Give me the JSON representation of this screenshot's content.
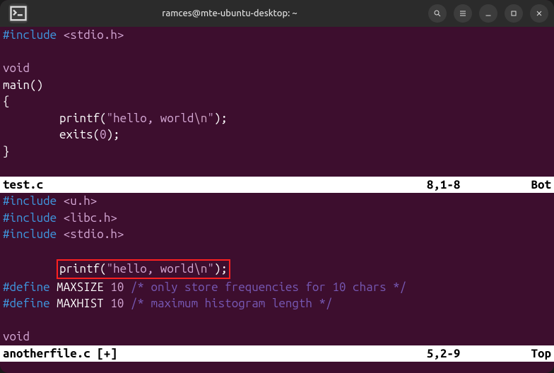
{
  "titlebar": {
    "title": "ramces@mte-ubuntu-desktop: ~"
  },
  "pane1": {
    "lines": {
      "l1_pre": "#include",
      "l1_hdr": "<stdio.h>",
      "l3_kw": "void",
      "l4": "main()",
      "l5": "{",
      "l6_fn": "printf(",
      "l6_str1": "\"hello, world",
      "l6_esc": "\\n",
      "l6_str2": "\"",
      "l6_end": ");",
      "l7_fn": "exits(",
      "l7_num": "0",
      "l7_end": ");",
      "l8": "}"
    },
    "status": {
      "filename": "test.c",
      "position": "8,1-8",
      "scroll": "Bot"
    }
  },
  "pane2": {
    "lines": {
      "l1_pre": "#include",
      "l1_hdr": "<u.h>",
      "l2_pre": "#include",
      "l2_hdr": "<libc.h>",
      "l3_pre": "#include",
      "l3_hdr": "<stdio.h>",
      "l5_fn": "printf(",
      "l5_str1": "\"hello, world",
      "l5_esc": "\\n",
      "l5_str2": "\"",
      "l5_end": ");",
      "l6_pre": "#define",
      "l6_mac": " MAXSIZE ",
      "l6_num": "10",
      "l6_com": " /* only store frequencies for 10 chars */",
      "l7_pre": "#define",
      "l7_mac": " MAXHIST ",
      "l7_num": "10",
      "l7_com": " /* maximum histogram length */",
      "l9_kw": "void"
    },
    "status": {
      "filename": "anotherfile.c [+]",
      "position": "5,2-9",
      "scroll": "Top"
    }
  }
}
